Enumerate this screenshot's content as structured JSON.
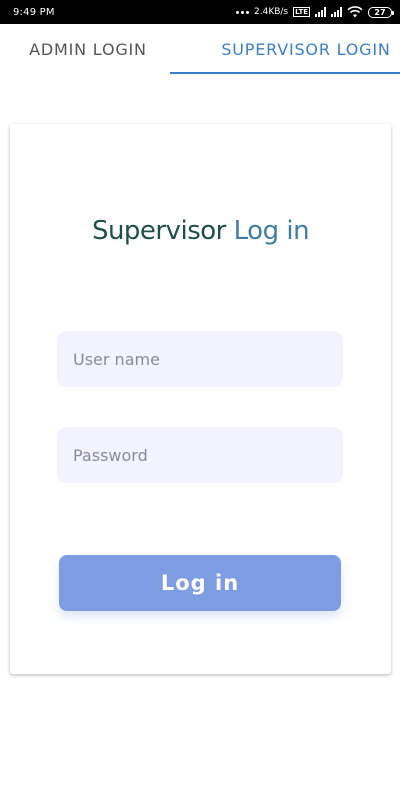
{
  "status_bar": {
    "time": "9:49 PM",
    "net_speed": "2.4KB/s",
    "volte_label": "Vo LTE",
    "battery_level": "27"
  },
  "tabs": [
    {
      "label": "ADMIN LOGIN",
      "active": false
    },
    {
      "label": "SUPERVISOR LOGIN",
      "active": true
    }
  ],
  "card": {
    "title_part1": "Supervisor",
    "title_part2": "Log in",
    "username_placeholder": "User name",
    "username_value": "",
    "password_placeholder": "Password",
    "password_value": "",
    "login_label": "Log in"
  },
  "colors": {
    "accent": "#3a7fc8",
    "title_dark": "#1f4f4a",
    "title_blue": "#3e7fa6",
    "input_bg": "#f3f3ff",
    "button_bg": "#7e9ce1"
  },
  "icons": [
    "more-dots-icon",
    "volte-icon",
    "signal-icon",
    "wifi-icon",
    "battery-icon"
  ]
}
